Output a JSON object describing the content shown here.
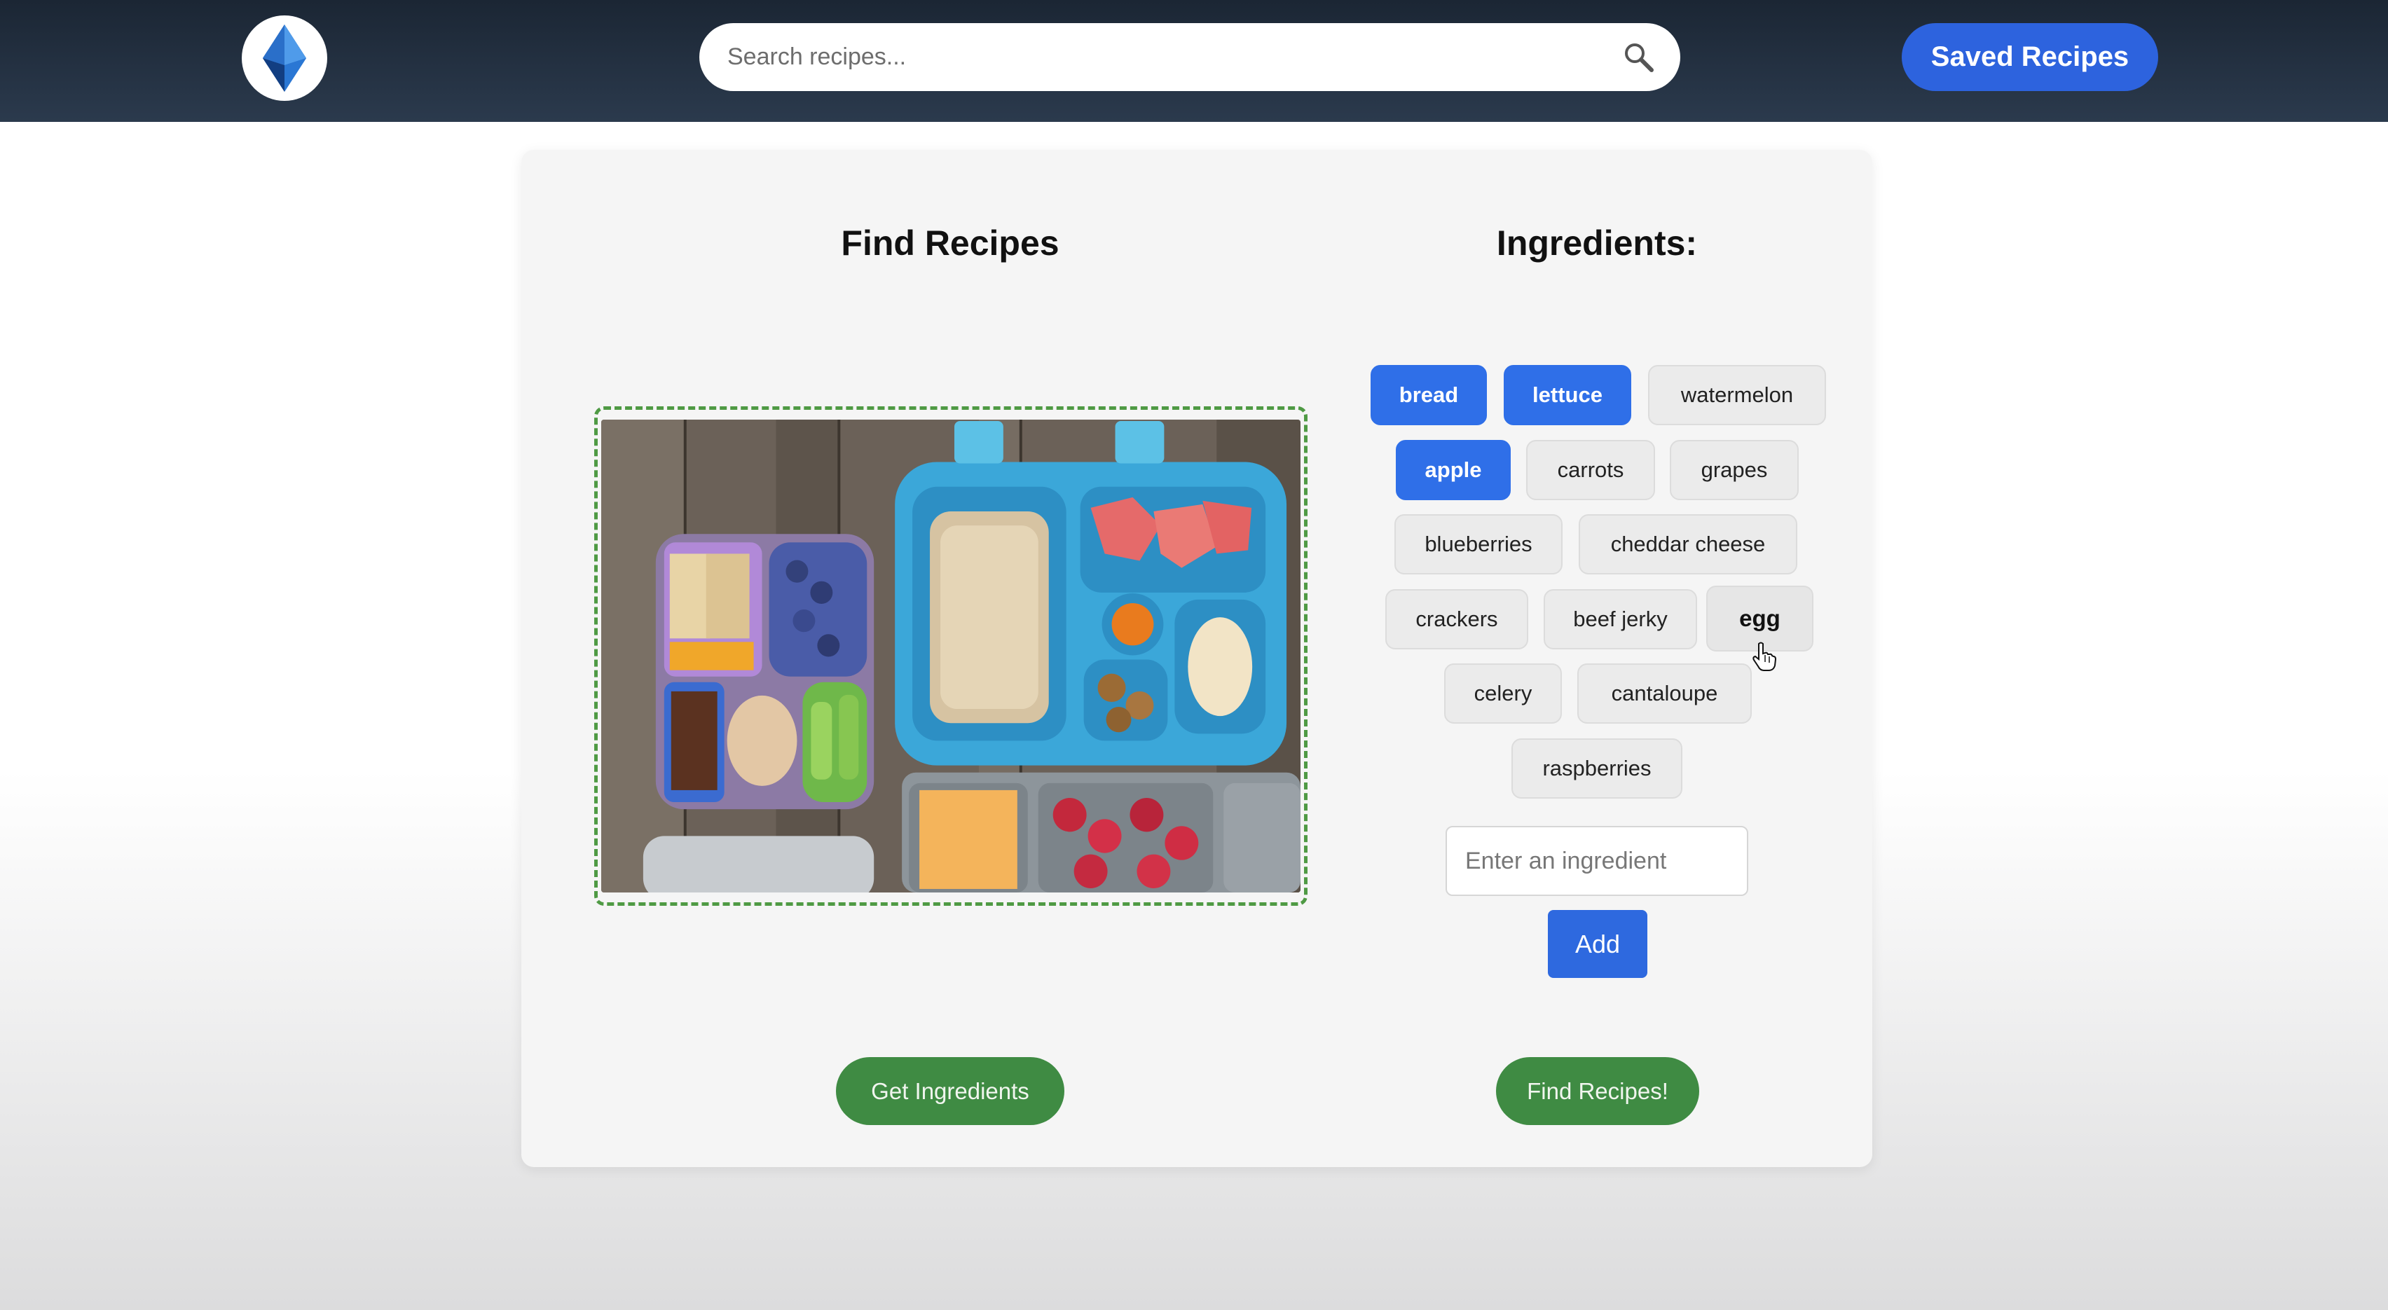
{
  "header": {
    "search_placeholder": "Search recipes...",
    "saved_label": "Saved Recipes"
  },
  "card": {
    "left_title": "Find Recipes",
    "right_title": "Ingredients:"
  },
  "ingredients": [
    {
      "label": "bread",
      "selected": true
    },
    {
      "label": "lettuce",
      "selected": true
    },
    {
      "label": "watermelon",
      "selected": false
    },
    {
      "label": "apple",
      "selected": true
    },
    {
      "label": "carrots",
      "selected": false
    },
    {
      "label": "grapes",
      "selected": false
    },
    {
      "label": "blueberries",
      "selected": false
    },
    {
      "label": "cheddar cheese",
      "selected": false
    },
    {
      "label": "crackers",
      "selected": false
    },
    {
      "label": "beef jerky",
      "selected": false
    },
    {
      "label": "egg",
      "selected": false
    },
    {
      "label": "celery",
      "selected": false
    },
    {
      "label": "cantaloupe",
      "selected": false
    },
    {
      "label": "raspberries",
      "selected": false
    }
  ],
  "ingredient_input": {
    "placeholder": "Enter an ingredient",
    "add_label": "Add"
  },
  "actions": {
    "get_ingredients_label": "Get Ingredients",
    "find_recipes_label": "Find Recipes!"
  },
  "colors": {
    "accent_blue": "#2f6fe8",
    "header_bg": "#1f2a38",
    "action_green": "#3f8b43",
    "dropzone_border": "#4f9a44"
  },
  "icons": {
    "logo": "diamond-logo-icon",
    "search": "search-icon",
    "cursor": "hand-pointer-icon"
  }
}
